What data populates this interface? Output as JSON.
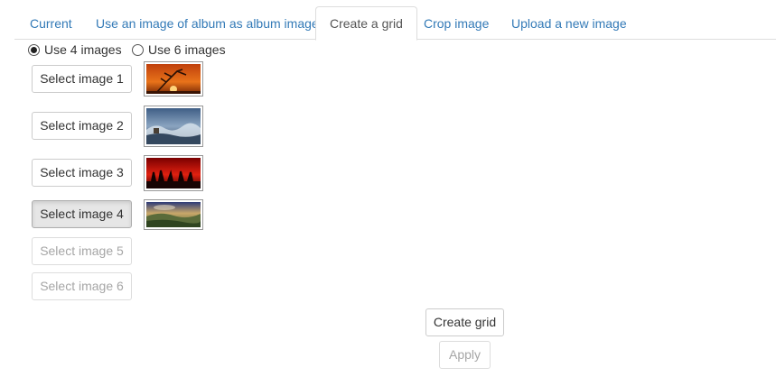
{
  "tabs": [
    {
      "label": "Current",
      "active": false
    },
    {
      "label": "Use an image of album as album image",
      "active": false
    },
    {
      "label": "Create a grid",
      "active": true
    },
    {
      "label": "Crop image",
      "active": false
    },
    {
      "label": "Upload a new image",
      "active": false
    }
  ],
  "grid_options": {
    "option_4": {
      "label": "Use 4 images",
      "checked": true
    },
    "option_6": {
      "label": "Use 6 images",
      "checked": false
    }
  },
  "image_slots": [
    {
      "button_label": "Select image 1",
      "state": "enabled",
      "thumbnail": "sunset-tree-photo"
    },
    {
      "button_label": "Select image 2",
      "state": "enabled",
      "thumbnail": "stormy-sea-photo"
    },
    {
      "button_label": "Select image 3",
      "state": "enabled",
      "thumbnail": "red-sunset-silhouettes-photo"
    },
    {
      "button_label": "Select image 4",
      "state": "pressed",
      "thumbnail": "valley-landscape-photo"
    },
    {
      "button_label": "Select image 5",
      "state": "disabled",
      "thumbnail": null
    },
    {
      "button_label": "Select image 6",
      "state": "disabled",
      "thumbnail": null
    }
  ],
  "actions": {
    "create_grid_label": "Create grid",
    "apply_label": "Apply",
    "apply_enabled": false
  },
  "colors": {
    "link": "#337ab7",
    "active_tab_text": "#555555",
    "border": "#dddddd",
    "disabled_text": "#a6a6a6"
  }
}
